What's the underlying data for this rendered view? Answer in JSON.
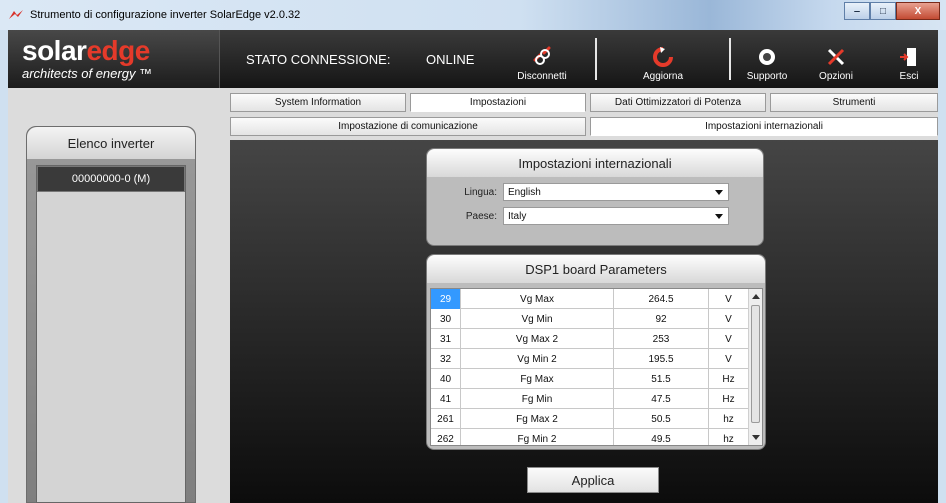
{
  "window": {
    "title": "Strumento di configurazione inverter SolarEdge v2.0.32",
    "controls": [
      "‒",
      "□",
      "X"
    ]
  },
  "header": {
    "logo_word_a": "solar",
    "logo_word_b": "edge",
    "logo_tagline": "architects of energy ™",
    "connection_label": "STATO CONNESSIONE:",
    "connection_value": "ONLINE",
    "buttons": {
      "disconnect": "Disconnetti",
      "update": "Aggiorna",
      "support": "Supporto",
      "options": "Opzioni",
      "exit": "Esci"
    }
  },
  "tabs": {
    "row1": [
      "System Information",
      "Impostazioni",
      "Dati Ottimizzatori di Potenza",
      "Strumenti"
    ],
    "row2": [
      "Impostazione di comunicazione",
      "Impostazioni internazionali"
    ]
  },
  "inverter_list": {
    "title": "Elenco inverter",
    "items": [
      "00000000-0 (M)"
    ]
  },
  "intl": {
    "title": "Impostazioni internazionali",
    "language_label": "Lingua:",
    "language_value": "English",
    "country_label": "Paese:",
    "country_value": "Italy"
  },
  "dsp": {
    "title": "DSP1 board Parameters",
    "rows": [
      {
        "id": "29",
        "name": "Vg Max",
        "value": "264.5",
        "unit": "V"
      },
      {
        "id": "30",
        "name": "Vg Min",
        "value": "92",
        "unit": "V"
      },
      {
        "id": "31",
        "name": "Vg Max 2",
        "value": "253",
        "unit": "V"
      },
      {
        "id": "32",
        "name": "Vg Min 2",
        "value": "195.5",
        "unit": "V"
      },
      {
        "id": "40",
        "name": "Fg Max",
        "value": "51.5",
        "unit": "Hz"
      },
      {
        "id": "41",
        "name": "Fg Min",
        "value": "47.5",
        "unit": "Hz"
      },
      {
        "id": "261",
        "name": "Fg Max 2",
        "value": "50.5",
        "unit": "hz"
      },
      {
        "id": "262",
        "name": "Fg Min 2",
        "value": "49.5",
        "unit": "hz"
      }
    ]
  },
  "apply_label": "Applica",
  "colors": {
    "brand_red": "#e53a2a",
    "selection_blue": "#3399ff"
  }
}
